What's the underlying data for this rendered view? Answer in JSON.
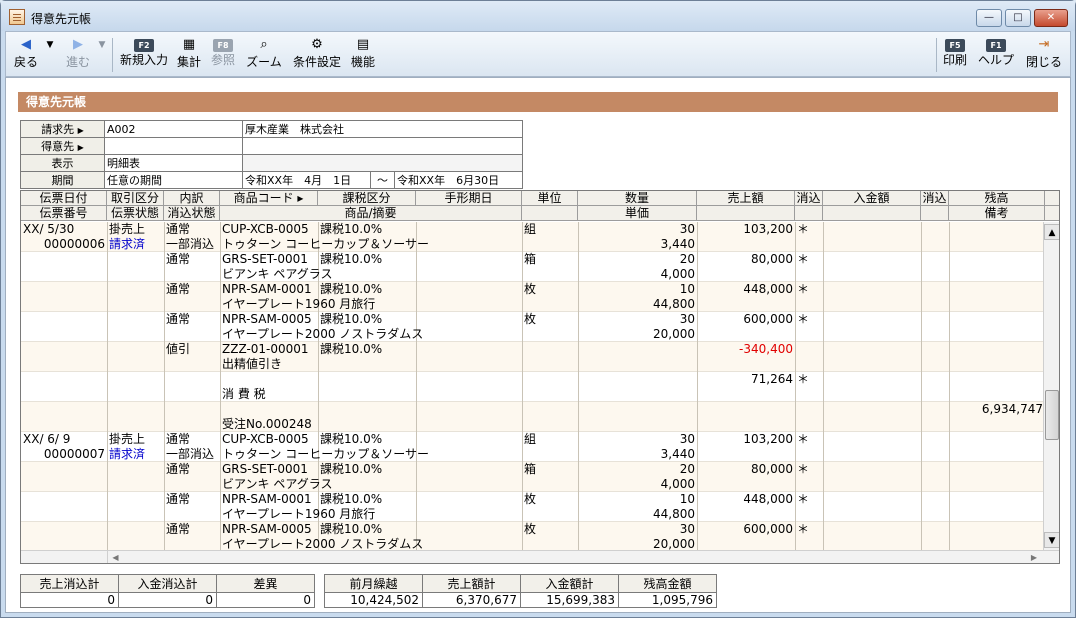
{
  "window": {
    "title": "得意先元帳",
    "min": "—",
    "max": "□",
    "close": "✕"
  },
  "toolbar": {
    "back": "戻る",
    "forward": "進む",
    "new_label": "新規入力",
    "new_key": "F2",
    "total": "集計",
    "ref": "参照",
    "ref_key": "F8",
    "zoom": "ズーム",
    "cond": "条件設定",
    "func": "機能",
    "print": "印刷",
    "print_key": "F5",
    "help": "ヘルプ",
    "help_key": "F1",
    "close": "閉じる"
  },
  "section_title": "得意先元帳",
  "info": {
    "billing_label": "請求先",
    "billing_code": "A002",
    "billing_name": "厚木産業　株式会社",
    "customer_label": "得意先",
    "display_label": "表示",
    "display_value": "明細表",
    "period_label": "期間",
    "period_value": "任意の期間",
    "period_from": "令和XX年　4月　1日",
    "period_sep": "～",
    "period_to": "令和XX年　6月30日"
  },
  "headers": {
    "r1": [
      "伝票日付",
      "取引区分",
      "内訳",
      "商品コード ▸",
      "課税区分",
      "手形期日",
      "単位",
      "数量",
      "売上額",
      "消込",
      "入金額",
      "消込",
      "残高"
    ],
    "r2": [
      "伝票番号",
      "伝票状態",
      "消込状態",
      "商品/摘要",
      "単価",
      "備考"
    ]
  },
  "rows": [
    {
      "date": "XX/ 5/30",
      "voucher": "00000006",
      "kind": "掛売上",
      "status": "請求済",
      "breakdown": "通常",
      "clear_status": "一部消込",
      "code": "CUP-XCB-0005",
      "tax": "課税10.0%",
      "desc": "トゥターン コーヒーカップ＆ソーサー",
      "unit": "組",
      "qty": "30",
      "price": "3,440",
      "sales": "103,200",
      "mark": "＊",
      "balance": "",
      "note": ""
    },
    {
      "date": "",
      "voucher": "",
      "kind": "",
      "status": "",
      "breakdown": "通常",
      "clear_status": "",
      "code": "GRS-SET-0001",
      "tax": "課税10.0%",
      "desc": "ビアンキ ペアグラス",
      "unit": "箱",
      "qty": "20",
      "price": "4,000",
      "sales": "80,000",
      "mark": "＊",
      "balance": "",
      "note": ""
    },
    {
      "date": "",
      "voucher": "",
      "kind": "",
      "status": "",
      "breakdown": "通常",
      "clear_status": "",
      "code": "NPR-SAM-0001",
      "tax": "課税10.0%",
      "desc": "イヤープレート1960 月旅行",
      "unit": "枚",
      "qty": "10",
      "price": "44,800",
      "sales": "448,000",
      "mark": "＊",
      "balance": "",
      "note": ""
    },
    {
      "date": "",
      "voucher": "",
      "kind": "",
      "status": "",
      "breakdown": "通常",
      "clear_status": "",
      "code": "NPR-SAM-0005",
      "tax": "課税10.0%",
      "desc": "イヤープレート2000 ノストラダムス",
      "unit": "枚",
      "qty": "30",
      "price": "20,000",
      "sales": "600,000",
      "mark": "＊",
      "balance": "",
      "note": ""
    },
    {
      "date": "",
      "voucher": "",
      "kind": "",
      "status": "",
      "breakdown": "値引",
      "clear_status": "",
      "code": "ZZZ-01-00001",
      "tax": "課税10.0%",
      "desc": "出精値引き",
      "unit": "",
      "qty": "",
      "price": "",
      "sales": "-340,400",
      "mark": "",
      "balance": "",
      "note": "",
      "red": true
    },
    {
      "date": "",
      "voucher": "",
      "kind": "",
      "status": "",
      "breakdown": "",
      "clear_status": "",
      "code": "",
      "tax": "",
      "desc": "消 費 税",
      "unit": "",
      "qty": "",
      "price": "",
      "sales": "71,264",
      "mark": "＊",
      "balance": "",
      "note": ""
    },
    {
      "date": "",
      "voucher": "",
      "kind": "",
      "status": "",
      "breakdown": "",
      "clear_status": "",
      "code": "",
      "tax": "",
      "desc": "受注No.000248",
      "unit": "",
      "qty": "",
      "price": "",
      "sales": "",
      "mark": "",
      "balance": "6,934,747",
      "note": ""
    },
    {
      "date": "XX/ 6/ 9",
      "voucher": "00000007",
      "kind": "掛売上",
      "status": "請求済",
      "breakdown": "通常",
      "clear_status": "一部消込",
      "code": "CUP-XCB-0005",
      "tax": "課税10.0%",
      "desc": "トゥターン コーヒーカップ＆ソーサー",
      "unit": "組",
      "qty": "30",
      "price": "3,440",
      "sales": "103,200",
      "mark": "＊",
      "balance": "",
      "note": ""
    },
    {
      "date": "",
      "voucher": "",
      "kind": "",
      "status": "",
      "breakdown": "通常",
      "clear_status": "",
      "code": "GRS-SET-0001",
      "tax": "課税10.0%",
      "desc": "ビアンキ ペアグラス",
      "unit": "箱",
      "qty": "20",
      "price": "4,000",
      "sales": "80,000",
      "mark": "＊",
      "balance": "",
      "note": ""
    },
    {
      "date": "",
      "voucher": "",
      "kind": "",
      "status": "",
      "breakdown": "通常",
      "clear_status": "",
      "code": "NPR-SAM-0001",
      "tax": "課税10.0%",
      "desc": "イヤープレート1960 月旅行",
      "unit": "枚",
      "qty": "10",
      "price": "44,800",
      "sales": "448,000",
      "mark": "＊",
      "balance": "",
      "note": ""
    },
    {
      "date": "",
      "voucher": "",
      "kind": "",
      "status": "",
      "breakdown": "通常",
      "clear_status": "",
      "code": "NPR-SAM-0005",
      "tax": "課税10.0%",
      "desc": "イヤープレート2000 ノストラダムス",
      "unit": "枚",
      "qty": "30",
      "price": "20,000",
      "sales": "600,000",
      "mark": "＊",
      "balance": "",
      "note": ""
    }
  ],
  "summary_left": {
    "headers": [
      "売上消込計",
      "入金消込計",
      "差異"
    ],
    "values": [
      "0",
      "0",
      "0"
    ]
  },
  "summary_right": {
    "headers": [
      "前月繰越",
      "売上額計",
      "入金額計",
      "残高金額"
    ],
    "values": [
      "10,424,502",
      "6,370,677",
      "15,699,383",
      "1,095,796"
    ]
  }
}
